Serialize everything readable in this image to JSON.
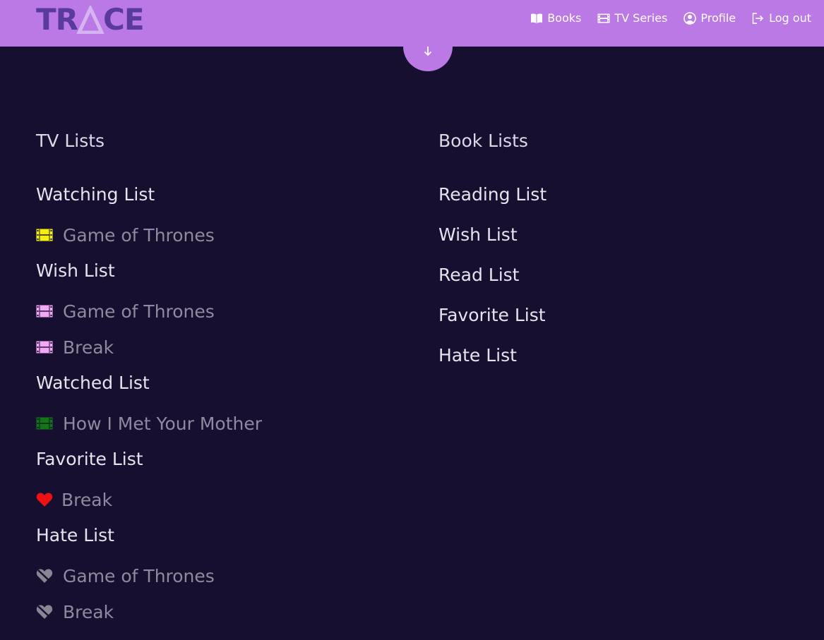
{
  "brand": {
    "logo_text_left": "TR",
    "logo_text_right": "CE"
  },
  "nav": {
    "books": "Books",
    "tv_series": "TV Series",
    "profile": "Profile",
    "logout": "Log out"
  },
  "colors": {
    "navbar": "#bb79e6",
    "background": "#160f30",
    "watching_icon": "#f5f10f",
    "wish_icon": "#f3a8f5",
    "watched_icon": "#0f7a13",
    "favorite_icon": "#ee1111",
    "hate_icon": "#8a8592"
  },
  "tv_lists": {
    "title": "TV Lists",
    "watching": {
      "label": "Watching List",
      "items": [
        {
          "title": "Game of Thrones",
          "icon": "film-icon"
        }
      ]
    },
    "wish": {
      "label": "Wish List",
      "items": [
        {
          "title": "Game of Thrones",
          "icon": "film-icon"
        },
        {
          "title": "Break",
          "icon": "film-icon"
        }
      ]
    },
    "watched": {
      "label": "Watched List",
      "items": [
        {
          "title": "How I Met Your Mother",
          "icon": "film-icon"
        }
      ]
    },
    "favorite": {
      "label": "Favorite List",
      "items": [
        {
          "title": "Break",
          "icon": "heart-icon"
        }
      ]
    },
    "hate": {
      "label": "Hate List",
      "items": [
        {
          "title": "Game of Thrones",
          "icon": "broken-heart-icon"
        },
        {
          "title": "Break",
          "icon": "broken-heart-icon"
        }
      ]
    }
  },
  "book_lists": {
    "title": "Book Lists",
    "items": [
      {
        "label": "Reading List"
      },
      {
        "label": "Wish List"
      },
      {
        "label": "Read List"
      },
      {
        "label": "Favorite List"
      },
      {
        "label": "Hate List"
      }
    ]
  }
}
